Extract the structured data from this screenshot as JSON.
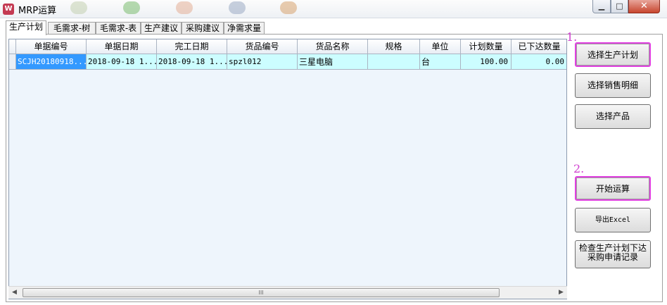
{
  "window": {
    "title": "MRP运算",
    "icon": "app-logo-icon",
    "controls": {
      "minimize": "▁",
      "maximize": "□",
      "close": "✕"
    }
  },
  "tabs": [
    {
      "label": "生产计划",
      "active": true
    },
    {
      "label": "毛需求-树",
      "active": false
    },
    {
      "label": "毛需求-表",
      "active": false
    },
    {
      "label": "生产建议",
      "active": false
    },
    {
      "label": "采购建议",
      "active": false
    },
    {
      "label": "净需求量",
      "active": false
    }
  ],
  "grid": {
    "columns": [
      "单据编号",
      "单据日期",
      "完工日期",
      "货品编号",
      "货品名称",
      "规格",
      "单位",
      "计划数量",
      "已下达数量"
    ],
    "rows": [
      [
        "SCJH20180918...",
        "2018-09-18 1...",
        "2018-09-18 1...",
        "spzl012",
        "三星电脑",
        "",
        "台",
        "100.00",
        "0.00"
      ]
    ]
  },
  "scrollbar": {
    "left": "◀",
    "right": "▶",
    "grip": "III"
  },
  "buttons": {
    "select_plan": "选择生产计划",
    "select_sales": "选择销售明细",
    "select_product": "选择产品",
    "start_calc": "开始运算",
    "export_excel": "导出Excel",
    "check_records_line1": "检查生产计划下达",
    "check_records_line2": "采购申请记录"
  },
  "annotations": {
    "step1": "1.",
    "step2": "2."
  },
  "colors": {
    "highlight": "#e040e0",
    "selected_cell": "#3399ff",
    "row_bg": "#ccfdff"
  }
}
